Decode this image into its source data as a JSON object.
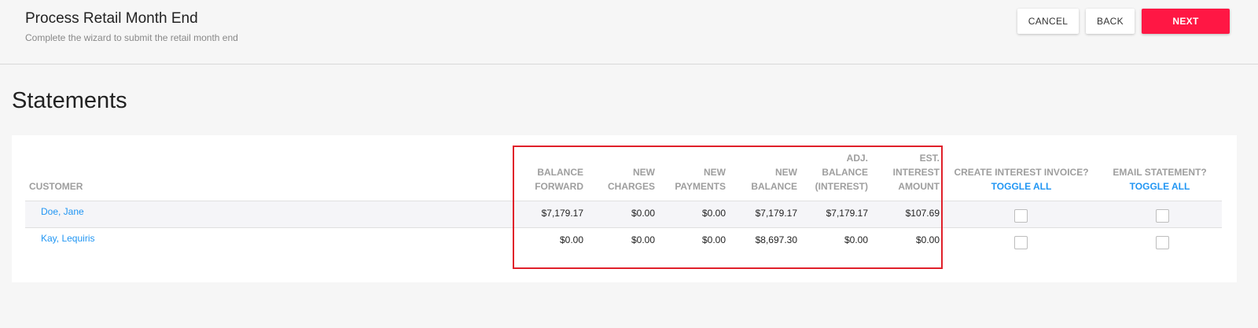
{
  "header": {
    "title": "Process Retail Month End",
    "subtitle": "Complete the wizard to submit the retail month end",
    "cancel_label": "CANCEL",
    "back_label": "BACK",
    "next_label": "NEXT"
  },
  "section": {
    "title": "Statements"
  },
  "table": {
    "headers": {
      "customer": "CUSTOMER",
      "balance_forward": [
        "BALANCE",
        "FORWARD"
      ],
      "new_charges": [
        "NEW",
        "CHARGES"
      ],
      "new_payments": [
        "NEW",
        "PAYMENTS"
      ],
      "new_balance": [
        "NEW",
        "BALANCE"
      ],
      "adj_balance": [
        "ADJ.",
        "BALANCE",
        "(INTEREST)"
      ],
      "est_interest": [
        "EST.",
        "INTEREST",
        "AMOUNT"
      ],
      "create_interest": "CREATE INTEREST INVOICE?",
      "email_statement": "EMAIL STATEMENT?",
      "toggle_all": "TOGGLE ALL"
    },
    "rows": [
      {
        "customer": "Doe, Jane",
        "balance_forward": "$7,179.17",
        "new_charges": "$0.00",
        "new_payments": "$0.00",
        "new_balance": "$7,179.17",
        "adj_balance": "$7,179.17",
        "est_interest": "$107.69",
        "create_interest_checked": false,
        "email_statement_checked": false
      },
      {
        "customer": "Kay, Lequiris",
        "balance_forward": "$0.00",
        "new_charges": "$0.00",
        "new_payments": "$0.00",
        "new_balance": "$8,697.30",
        "adj_balance": "$0.00",
        "est_interest": "$0.00",
        "create_interest_checked": false,
        "email_statement_checked": false
      }
    ]
  },
  "colors": {
    "accent": "#ff1744",
    "link": "#2196f3",
    "highlight": "#e0202a"
  }
}
